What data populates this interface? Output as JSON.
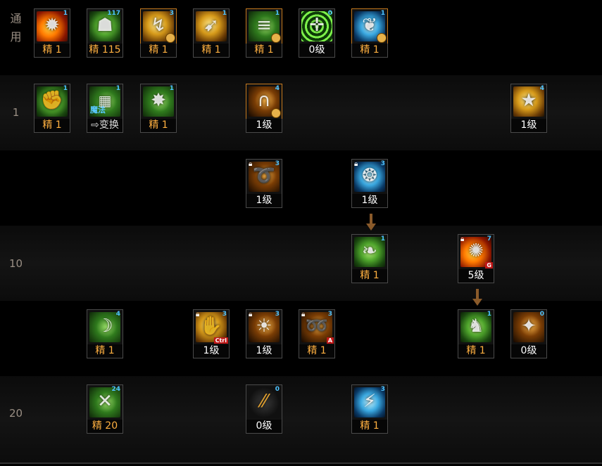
{
  "rows": {
    "common": {
      "label_line1": "通",
      "label_line2": "用"
    },
    "level1": {
      "label": "1"
    },
    "level10": {
      "label": "10"
    },
    "level20": {
      "label": "20"
    }
  },
  "skills": {
    "s0": {
      "count": "1",
      "label": "精 1",
      "icon": "fire-burst-icon"
    },
    "s1": {
      "count": "117",
      "label": "精 115",
      "icon": "green-beast-icon"
    },
    "s2": {
      "count": "3",
      "label": "精 1",
      "icon": "gold-kick-icon"
    },
    "s3": {
      "count": "1",
      "label": "精 1",
      "icon": "gold-crouch-icon"
    },
    "s4": {
      "count": "1",
      "label": "精 1",
      "icon": "green-dash-icon"
    },
    "s5": {
      "count": "0",
      "label": "0级",
      "icon": "green-target-icon"
    },
    "s6": {
      "count": "1",
      "label": "精 1",
      "icon": "blue-wings-icon"
    },
    "s7": {
      "count": "1",
      "label": "精 1",
      "icon": "green-fist-icon"
    },
    "s8": {
      "count": "1",
      "label": "⇨变换",
      "icon": "magic-book-icon",
      "overlay": "魔法"
    },
    "s9": {
      "count": "1",
      "label": "精 1",
      "icon": "green-spark-icon"
    },
    "s10": {
      "count": "4",
      "label": "1级",
      "icon": "gold-uppercut-icon"
    },
    "s11": {
      "count": "4",
      "label": "1级",
      "icon": "comet-icon"
    },
    "s12": {
      "count": "3",
      "label": "1级",
      "icon": "gold-swirl-kick-icon"
    },
    "s13": {
      "count": "3",
      "label": "1级",
      "icon": "blue-vortex-icon"
    },
    "s14": {
      "count": "1",
      "label": "精 1",
      "icon": "green-leaf-icon"
    },
    "s15": {
      "count": "7",
      "label": "5级",
      "icon": "gold-explosion-icon",
      "badge": "G"
    },
    "s16": {
      "count": "4",
      "label": "精 1",
      "icon": "green-slash-icon"
    },
    "s17": {
      "count": "3",
      "label": "1级",
      "icon": "gold-palm-icon",
      "badge": "Ctrl"
    },
    "s18": {
      "count": "3",
      "label": "1级",
      "icon": "gold-sunburst-icon"
    },
    "s19": {
      "count": "3",
      "label": "精 1",
      "icon": "gold-spiral-icon",
      "badge": "A"
    },
    "s20": {
      "count": "1",
      "label": "精 1",
      "icon": "green-fighter-icon"
    },
    "s21": {
      "count": "0",
      "label": "0级",
      "icon": "gold-shatter-icon"
    },
    "s22": {
      "count": "24",
      "label": "精 20",
      "icon": "green-crossed-blades-icon"
    },
    "s23": {
      "count": "0",
      "label": "0级",
      "icon": "gold-claw-icon"
    },
    "s24": {
      "count": "3",
      "label": "精 1",
      "icon": "blue-runner-icon"
    }
  },
  "colors": {
    "orange_text": "#ffb040",
    "count_text": "#4fc3ff",
    "arrow": "#8a5a2a",
    "row_label": "#9a8f84"
  }
}
